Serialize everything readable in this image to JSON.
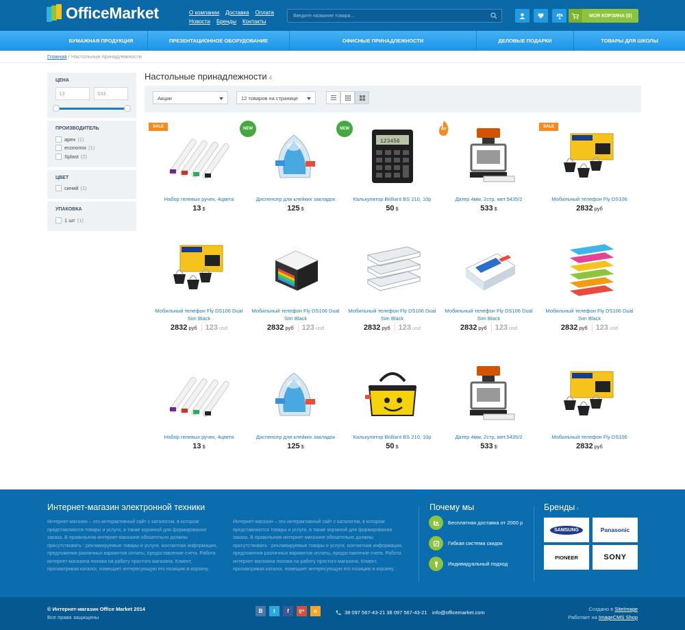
{
  "header": {
    "logo_text": "OfficeMarket",
    "links_row1": [
      "О компании",
      "Доставка",
      "Оплата"
    ],
    "links_row2": [
      "Новости",
      "Бренды",
      "Контакты"
    ],
    "search_placeholder": "Введите название товара...",
    "cart_label": "МОЯ КОРЗИНА (0)"
  },
  "nav": [
    "БУМАЖНАЯ ПРОДУКЦИЯ",
    "ПРЕЗЕНТАЦИОННОЕ ОБОРУДОВАНИЕ",
    "ОФИСНЫЕ ПРИНАДЛЕЖНОСТИ",
    "ДЕЛОВЫЕ ПОДАРКИ",
    "ТОВАРЫ ДЛЯ ШКОЛЫ"
  ],
  "breadcrumb": {
    "home": "Главная",
    "sep": "/",
    "current": "Настольные принадлежности"
  },
  "filters": {
    "price_title": "ЦЕНА",
    "price_min": "13",
    "price_max": "533",
    "maker_title": "ПРОИЗВОДИТЕЛЬ",
    "makers": [
      {
        "name": "apex",
        "count": "(1)"
      },
      {
        "name": "economix",
        "count": "(1)"
      },
      {
        "name": "Splast",
        "count": "(2)"
      }
    ],
    "color_title": "ЦВЕТ",
    "colors": [
      {
        "name": "синий",
        "count": "(1)"
      }
    ],
    "pack_title": "УПАКОВКА",
    "packs": [
      {
        "name": "1 шт",
        "count": "(1)"
      }
    ]
  },
  "catalog": {
    "title": "Настольные принадлежности",
    "count": "4",
    "sort_value": "Акции",
    "per_page_value": "12 товаров на странице"
  },
  "products": [
    {
      "name": "Набор гелевых ручек, 4цвета",
      "price": "13",
      "cur": "$",
      "badge": "SALE",
      "icon": "pens"
    },
    {
      "name": "Диспенсер для клейких закладок",
      "price": "125",
      "cur": "$",
      "badge": "NEW",
      "icon": "dispenser"
    },
    {
      "name": "Калькулятор Brilliant BS 210, 10р",
      "price": "50",
      "cur": "$",
      "badge": "NEW",
      "icon": "calculator"
    },
    {
      "name": "Датер 4мм, 2стр, мет.5435/2",
      "price": "533",
      "cur": "$",
      "badge": "HIT",
      "icon": "stamp"
    },
    {
      "name": "Мобильный телефон Fly DS106",
      "price": "2832",
      "cur": "руб",
      "badge": "SALE",
      "icon": "clips"
    },
    {
      "name": "Мобильный телефон Fly DS106 Dual Sim Black",
      "price": "2832",
      "cur": "руб",
      "old": "123",
      "old_cur": "usd",
      "icon": "clips"
    },
    {
      "name": "Мобильный телефон Fly DS106 Dual Sim Black",
      "price": "2832",
      "cur": "руб",
      "old": "123",
      "old_cur": "usd",
      "icon": "notecube"
    },
    {
      "name": "Мобильный телефон Fly DS106 Dual Sim Black",
      "price": "2832",
      "cur": "руб",
      "old": "123",
      "old_cur": "usd",
      "icon": "trays"
    },
    {
      "name": "Мобильный телефон Fly DS106 Dual Sim Black",
      "price": "2832",
      "cur": "руб",
      "old": "123",
      "old_cur": "usd",
      "icon": "paper"
    },
    {
      "name": "Мобильный телефон Fly DS106 Dual Sim Black",
      "price": "2832",
      "cur": "руб",
      "old": "123",
      "old_cur": "usd",
      "icon": "colortrays"
    },
    {
      "name": "Набор гелевых ручек, 4цвета",
      "price": "13",
      "cur": "$",
      "icon": "pens"
    },
    {
      "name": "Диспенсер для клейких закладок",
      "price": "125",
      "cur": "$",
      "icon": "dispenser"
    },
    {
      "name": "Калькулятор Brilliant BS 210, 10р",
      "price": "50",
      "cur": "$",
      "icon": "bag"
    },
    {
      "name": "Датер 4мм, 2стр, мет.5435/2",
      "price": "533",
      "cur": "$",
      "icon": "stamp"
    },
    {
      "name": "Мобильный телефон Fly DS106",
      "price": "2832",
      "cur": "руб",
      "icon": "clips"
    }
  ],
  "footer": {
    "about_title": "Интернет-магазин электронной техники",
    "about_text": "Интернет-магазин – это интерактивный сайт с каталогом, в котором представляются товары и услуги, а также корзиной для формирования заказа. В правильном интернет-магазине обязательно должны присутствовать : рекламируемые товары и услуги, контактная информация, предложения различных вариантов оплаты, предоставление счета. Работа интернет-магазина похожа на работу простого магазина. Клиент, просматривая каталог, помещает интересующую его позицию в корзину.",
    "why_title": "Почему мы",
    "why_items": [
      "Бесплатная доставка от 2000 р",
      "Гибкая система  скидок",
      "Индивидуальный подход"
    ],
    "brands_title": "Бренды",
    "brands": [
      "SAMSUNG",
      "Panasonic",
      "PIONEER",
      "SONY"
    ],
    "copyright": "© Интернет-магазин Office Market 2014",
    "rights": "Все права защищены",
    "social": [
      "B",
      "t",
      "f",
      "g+",
      "o"
    ],
    "phone": "38 097 567-43-21   38 097 567-43-21",
    "email": "info@officemarket.com",
    "created_prefix": "Создано в",
    "created_link": "SiteImage",
    "works_prefix": "Работает на",
    "works_link": "ImageCMS Shop"
  },
  "colors": {
    "header": "#0b69a8",
    "nav": "#1a94e6",
    "accent_green": "#8cc43c",
    "sale": "#f78a1d",
    "new": "#45a93f",
    "link": "#1a7bc0"
  }
}
